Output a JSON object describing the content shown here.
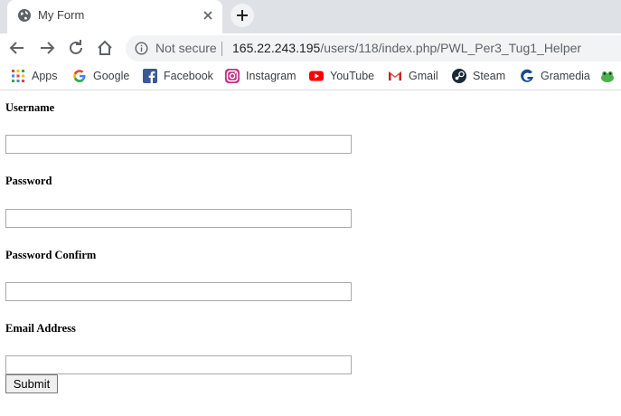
{
  "tab": {
    "title": "My Form"
  },
  "toolbar": {
    "security_text": "Not secure",
    "url_host": "165.22.243.195",
    "url_path": "/users/118/index.php/PWL_Per3_Tug1_Helper"
  },
  "bookmarks": [
    {
      "label": "Apps",
      "icon": "apps-grid-icon"
    },
    {
      "label": "Google",
      "icon": "google-icon"
    },
    {
      "label": "Facebook",
      "icon": "facebook-icon"
    },
    {
      "label": "Instagram",
      "icon": "instagram-icon"
    },
    {
      "label": "YouTube",
      "icon": "youtube-icon"
    },
    {
      "label": "Gmail",
      "icon": "gmail-icon"
    },
    {
      "label": "Steam",
      "icon": "steam-icon"
    },
    {
      "label": "Gramedia",
      "icon": "gramedia-icon"
    }
  ],
  "form": {
    "username_label": "Username",
    "username_value": "",
    "password_label": "Password",
    "password_value": "",
    "password_confirm_label": "Password Confirm",
    "password_confirm_value": "",
    "email_label": "Email Address",
    "email_value": "",
    "submit_label": "Submit"
  },
  "colors": {
    "tabstrip_bg": "#dee1e6",
    "omnibox_bg": "#f1f3f4",
    "text_muted": "#5f6368"
  }
}
